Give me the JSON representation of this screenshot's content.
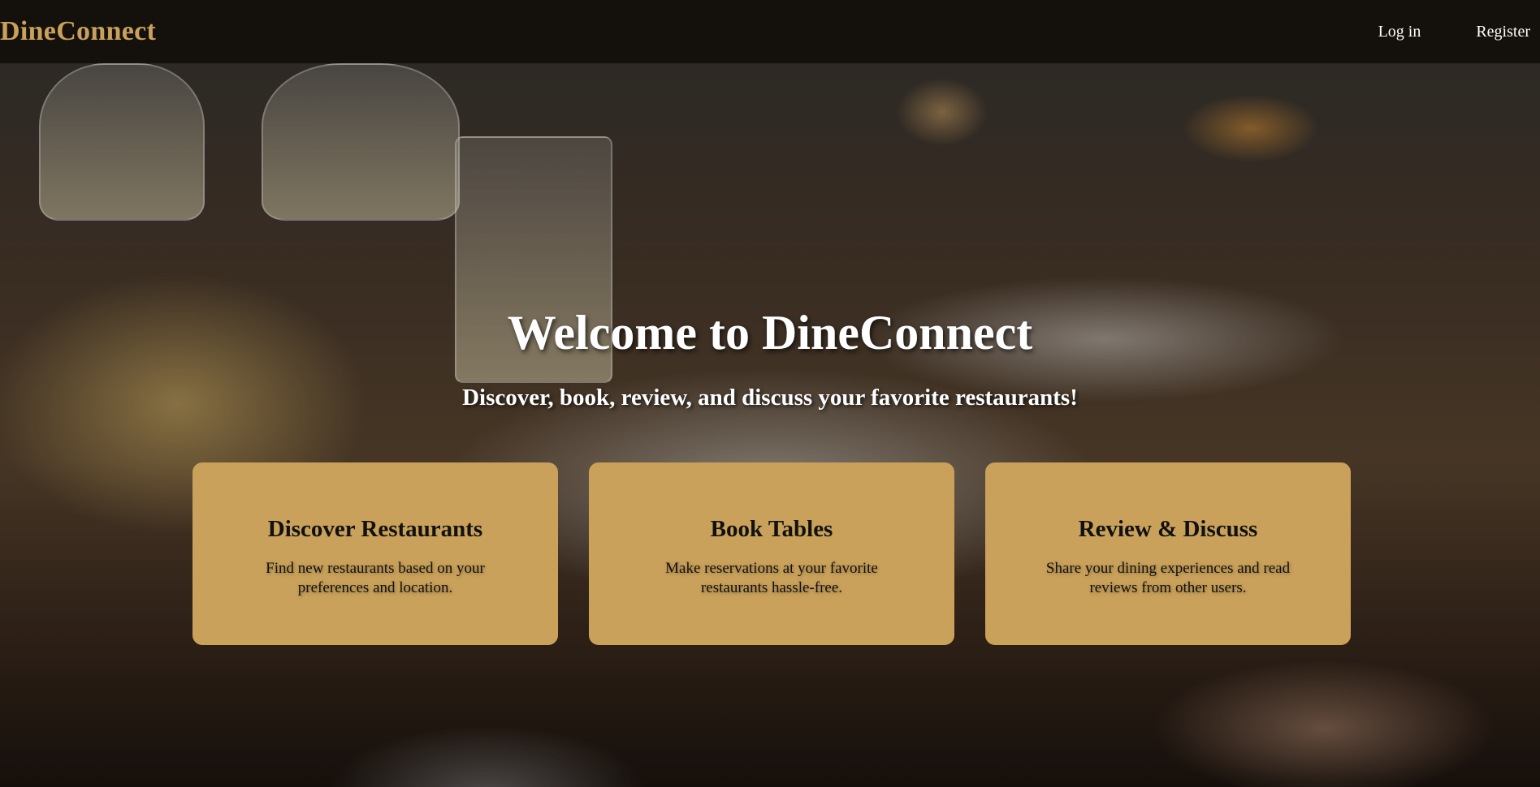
{
  "nav": {
    "brand": "DineConnect",
    "login_label": "Log in",
    "register_label": "Register"
  },
  "hero": {
    "title": "Welcome to DineConnect",
    "subtitle": "Discover, book, review, and discuss your favorite restaurants!"
  },
  "features": [
    {
      "title": "Discover Restaurants",
      "description": "Find new restaurants based on your preferences and location."
    },
    {
      "title": "Book Tables",
      "description": "Make reservations at your favorite restaurants hassle-free."
    },
    {
      "title": "Review & Discuss",
      "description": "Share your dining experiences and read reviews from other users."
    }
  ],
  "colors": {
    "nav_background": "#14110d",
    "brand": "#c9a15a",
    "card_background": "#c9a15a"
  }
}
